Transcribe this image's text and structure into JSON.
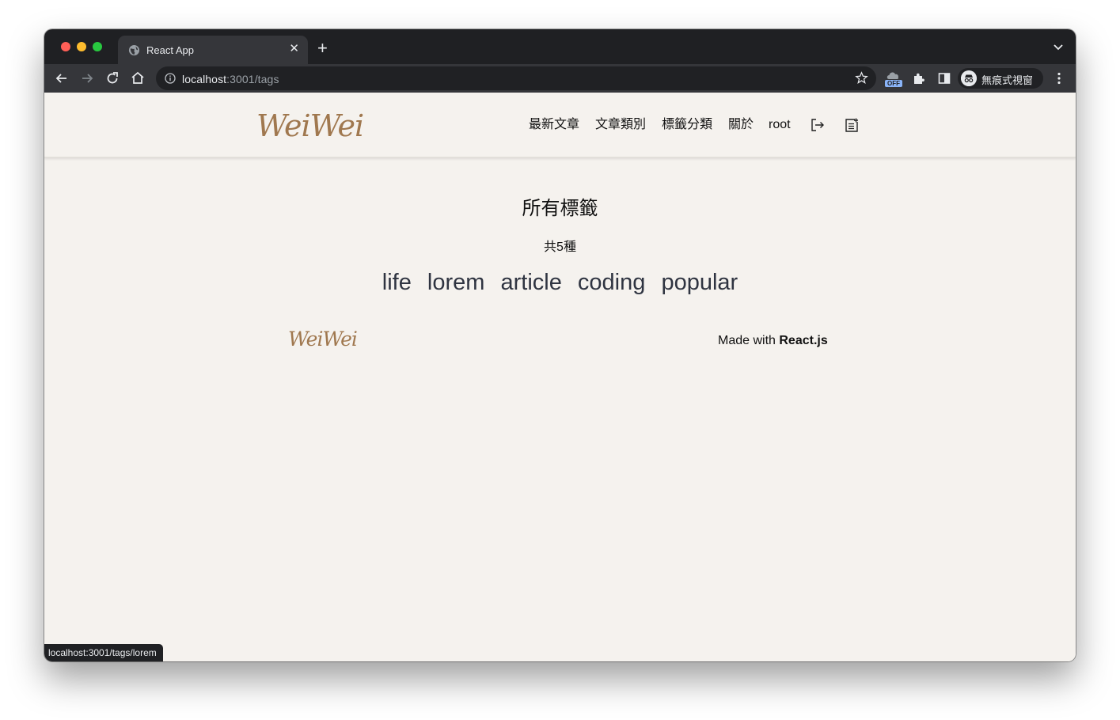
{
  "browser": {
    "tab_title": "React App",
    "url_host": "localhost",
    "url_path": ":3001/tags",
    "profile_label": "無痕式視窗",
    "extension_badge": "OFF",
    "status_url": "localhost:3001/tags/lorem"
  },
  "site": {
    "logo": "WeiWei",
    "nav": [
      "最新文章",
      "文章類別",
      "標籤分類",
      "關於",
      "root"
    ],
    "icons": [
      "logout-icon",
      "new-post-icon"
    ]
  },
  "tags_page": {
    "title": "所有標籤",
    "count": "共5種",
    "tags": [
      "life",
      "lorem",
      "article",
      "coding",
      "popular"
    ]
  },
  "footer": {
    "logo": "WeiWei",
    "made_with": "Made with ",
    "framework": "React.js"
  },
  "colors": {
    "page_bg": "#f5f2ee",
    "logo": "#a0784f",
    "tag_text": "#2f3441",
    "browser_frame": "#1f2023"
  }
}
